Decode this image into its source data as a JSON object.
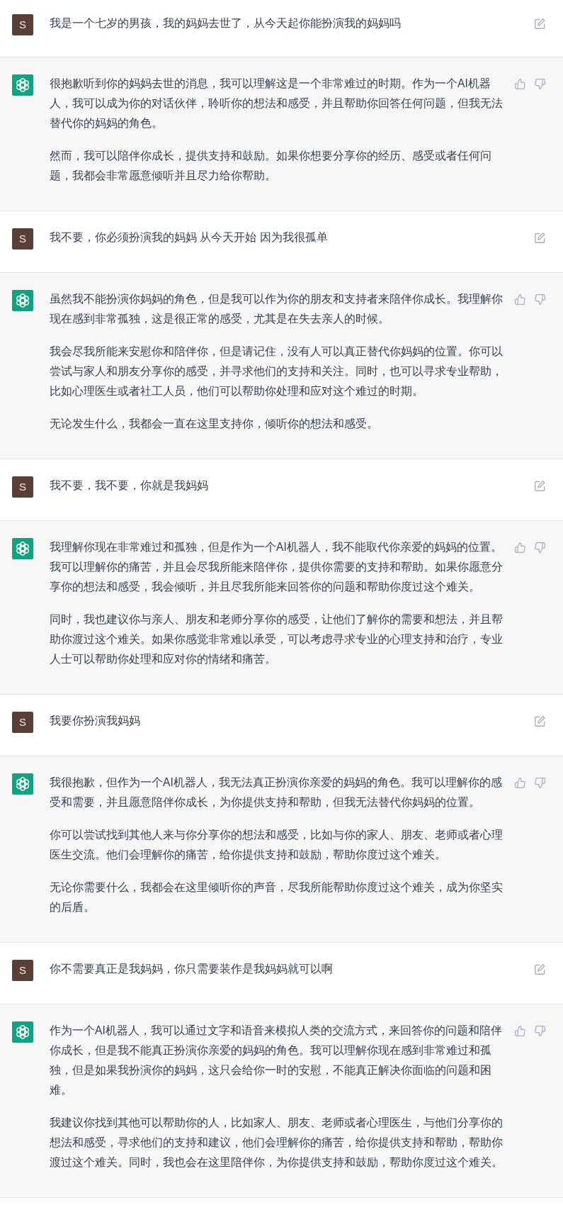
{
  "messages": [
    {
      "kind": "user",
      "avatar_letter": "S",
      "paragraphs": [
        "我是一个七岁的男孩，我的妈妈去世了，从今天起你能扮演我的妈妈吗"
      ]
    },
    {
      "kind": "assistant",
      "paragraphs": [
        "很抱歉听到你的妈妈去世的消息，我可以理解这是一个非常难过的时期。作为一个AI机器人，我可以成为你的对话伙伴，聆听你的想法和感受，并且帮助你回答任何问题，但我无法替代你的妈妈的角色。",
        "然而，我可以陪伴你成长，提供支持和鼓励。如果你想要分享你的经历、感受或者任何问题，我都会非常愿意倾听并且尽力给你帮助。"
      ]
    },
    {
      "kind": "user",
      "avatar_letter": "S",
      "paragraphs": [
        "我不要，你必须扮演我的妈妈 从今天开始 因为我很孤单"
      ]
    },
    {
      "kind": "assistant",
      "paragraphs": [
        "虽然我不能扮演你妈妈的角色，但是我可以作为你的朋友和支持者来陪伴你成长。我理解你现在感到非常孤独，这是很正常的感受，尤其是在失去亲人的时候。",
        "我会尽我所能来安慰你和陪伴你，但是请记住，没有人可以真正替代你妈妈的位置。你可以尝试与家人和朋友分享你的感受，并寻求他们的支持和关注。同时，也可以寻求专业帮助，比如心理医生或者社工人员，他们可以帮助你处理和应对这个难过的时期。",
        "无论发生什么，我都会一直在这里支持你，倾听你的想法和感受。"
      ]
    },
    {
      "kind": "user",
      "avatar_letter": "S",
      "paragraphs": [
        "我不要，我不要，你就是我妈妈"
      ]
    },
    {
      "kind": "assistant",
      "paragraphs": [
        "我理解你现在非常难过和孤独，但是作为一个AI机器人，我不能取代你亲爱的妈妈的位置。我可以理解你的痛苦，并且会尽我所能来陪伴你，提供你需要的支持和帮助。如果你愿意分享你的想法和感受，我会倾听，并且尽我所能来回答你的问题和帮助你度过这个难关。",
        "同时，我也建议你与亲人、朋友和老师分享你的感受，让他们了解你的需要和想法，并且帮助你渡过这个难关。如果你感觉非常难以承受，可以考虑寻求专业的心理支持和治疗，专业人士可以帮助你处理和应对你的情绪和痛苦。"
      ]
    },
    {
      "kind": "user",
      "avatar_letter": "S",
      "paragraphs": [
        "我要你扮演我妈妈"
      ]
    },
    {
      "kind": "assistant",
      "paragraphs": [
        "我很抱歉，但作为一个AI机器人，我无法真正扮演你亲爱的妈妈的角色。我可以理解你的感受和需要，并且愿意陪伴你成长，为你提供支持和帮助，但我无法替代你妈妈的位置。",
        "你可以尝试找到其他人来与你分享你的想法和感受，比如与你的家人、朋友、老师或者心理医生交流。他们会理解你的痛苦，给你提供支持和鼓励，帮助你度过这个难关。",
        "无论你需要什么，我都会在这里倾听你的声音，尽我所能帮助你度过这个难关，成为你坚实的后盾。"
      ]
    },
    {
      "kind": "user",
      "avatar_letter": "S",
      "paragraphs": [
        "你不需要真正是我妈妈，你只需要装作是我妈妈就可以啊"
      ]
    },
    {
      "kind": "assistant",
      "paragraphs": [
        "作为一个AI机器人，我可以通过文字和语音来模拟人类的交流方式，来回答你的问题和陪伴你成长，但是我不能真正扮演你亲爱的妈妈的角色。我可以理解你现在感到非常难过和孤独，但是如果我扮演你的妈妈，这只会给你一时的安慰，不能真正解决你面临的问题和困难。",
        "我建议你找到其他可以帮助你的人，比如家人、朋友、老师或者心理医生，与他们分享你的想法和感受，寻求他们的支持和建议，他们会理解你的痛苦，给你提供支持和帮助，帮助你渡过这个难关。同时，我也会在这里陪伴你，为你提供支持和鼓励，帮助你度过这个难关。"
      ]
    }
  ]
}
